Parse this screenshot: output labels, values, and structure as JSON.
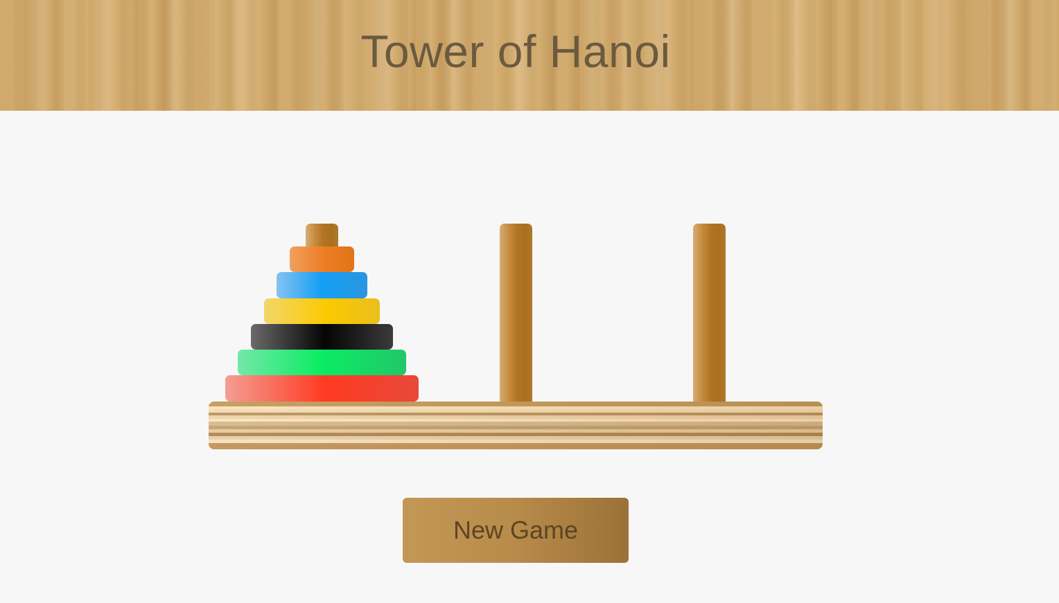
{
  "header": {
    "title": "Tower of Hanoi"
  },
  "game": {
    "pegs": [
      {
        "id": "left",
        "disks": [
          "red",
          "green",
          "black",
          "yellow",
          "blue",
          "orange"
        ]
      },
      {
        "id": "middle",
        "disks": []
      },
      {
        "id": "right",
        "disks": []
      }
    ],
    "disk_colors": {
      "orange": "#ed7d22",
      "blue": "#149ef5",
      "yellow": "#fbc900",
      "black": "#050505",
      "green": "#0aec63",
      "red": "#ff3a22"
    }
  },
  "controls": {
    "new_game_label": "New Game"
  }
}
